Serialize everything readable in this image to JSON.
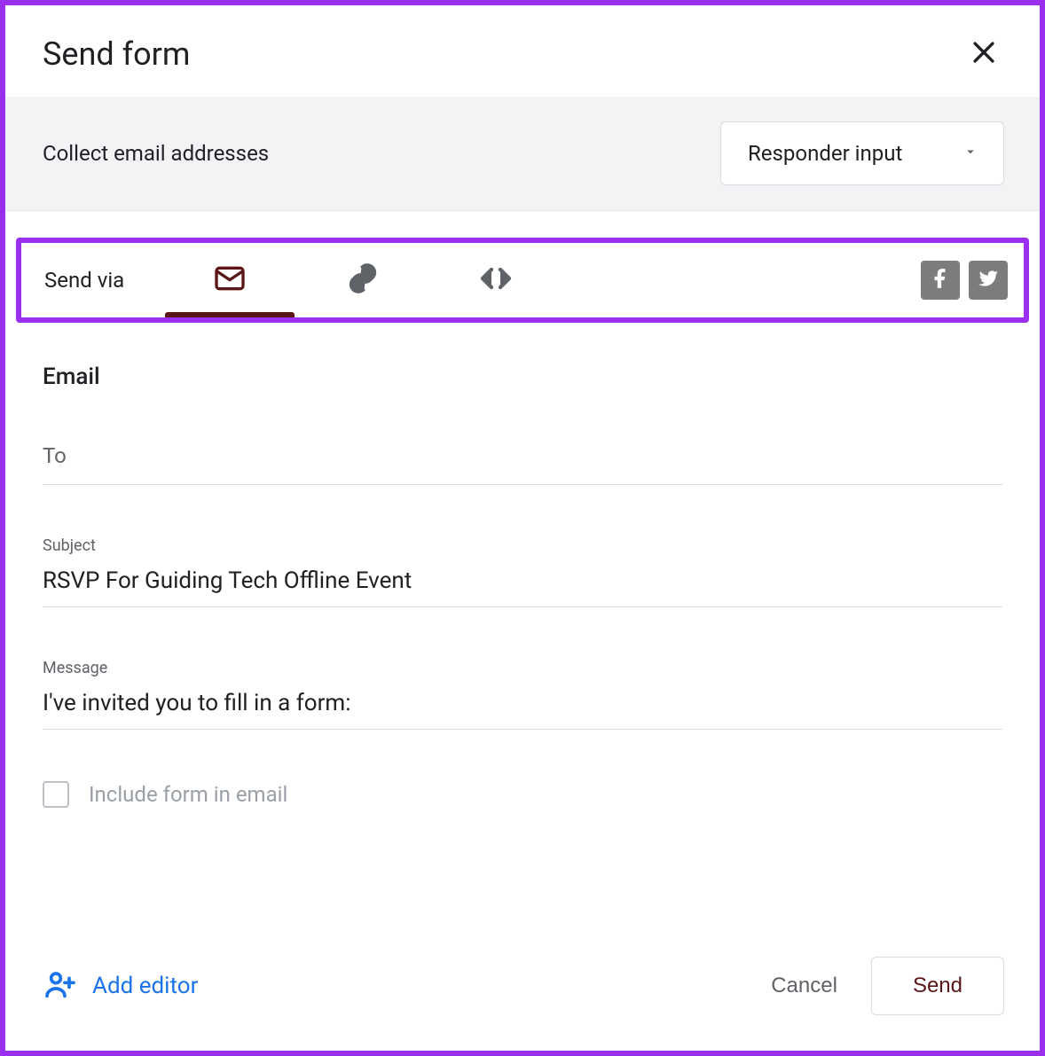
{
  "dialog": {
    "title": "Send form"
  },
  "collect": {
    "label": "Collect email addresses",
    "selected": "Responder input"
  },
  "sendvia": {
    "label": "Send via"
  },
  "email": {
    "heading": "Email",
    "to_label": "To",
    "to_value": "",
    "subject_label": "Subject",
    "subject_value": "RSVP For Guiding Tech Offline Event",
    "message_label": "Message",
    "message_value": "I've invited you to fill in a form:",
    "include_label": "Include form in email"
  },
  "footer": {
    "add_editor": "Add editor",
    "cancel": "Cancel",
    "send": "Send"
  },
  "icons": {
    "email": "email-icon",
    "link": "link-icon",
    "embed": "embed-icon",
    "facebook": "facebook-icon",
    "twitter": "twitter-icon",
    "close": "close-icon",
    "caret": "chevron-down-icon",
    "person_add": "person-add-icon"
  },
  "colors": {
    "accent": "#5a1617",
    "highlight_border": "#9a2ff0",
    "link_blue": "#1a73e8"
  }
}
